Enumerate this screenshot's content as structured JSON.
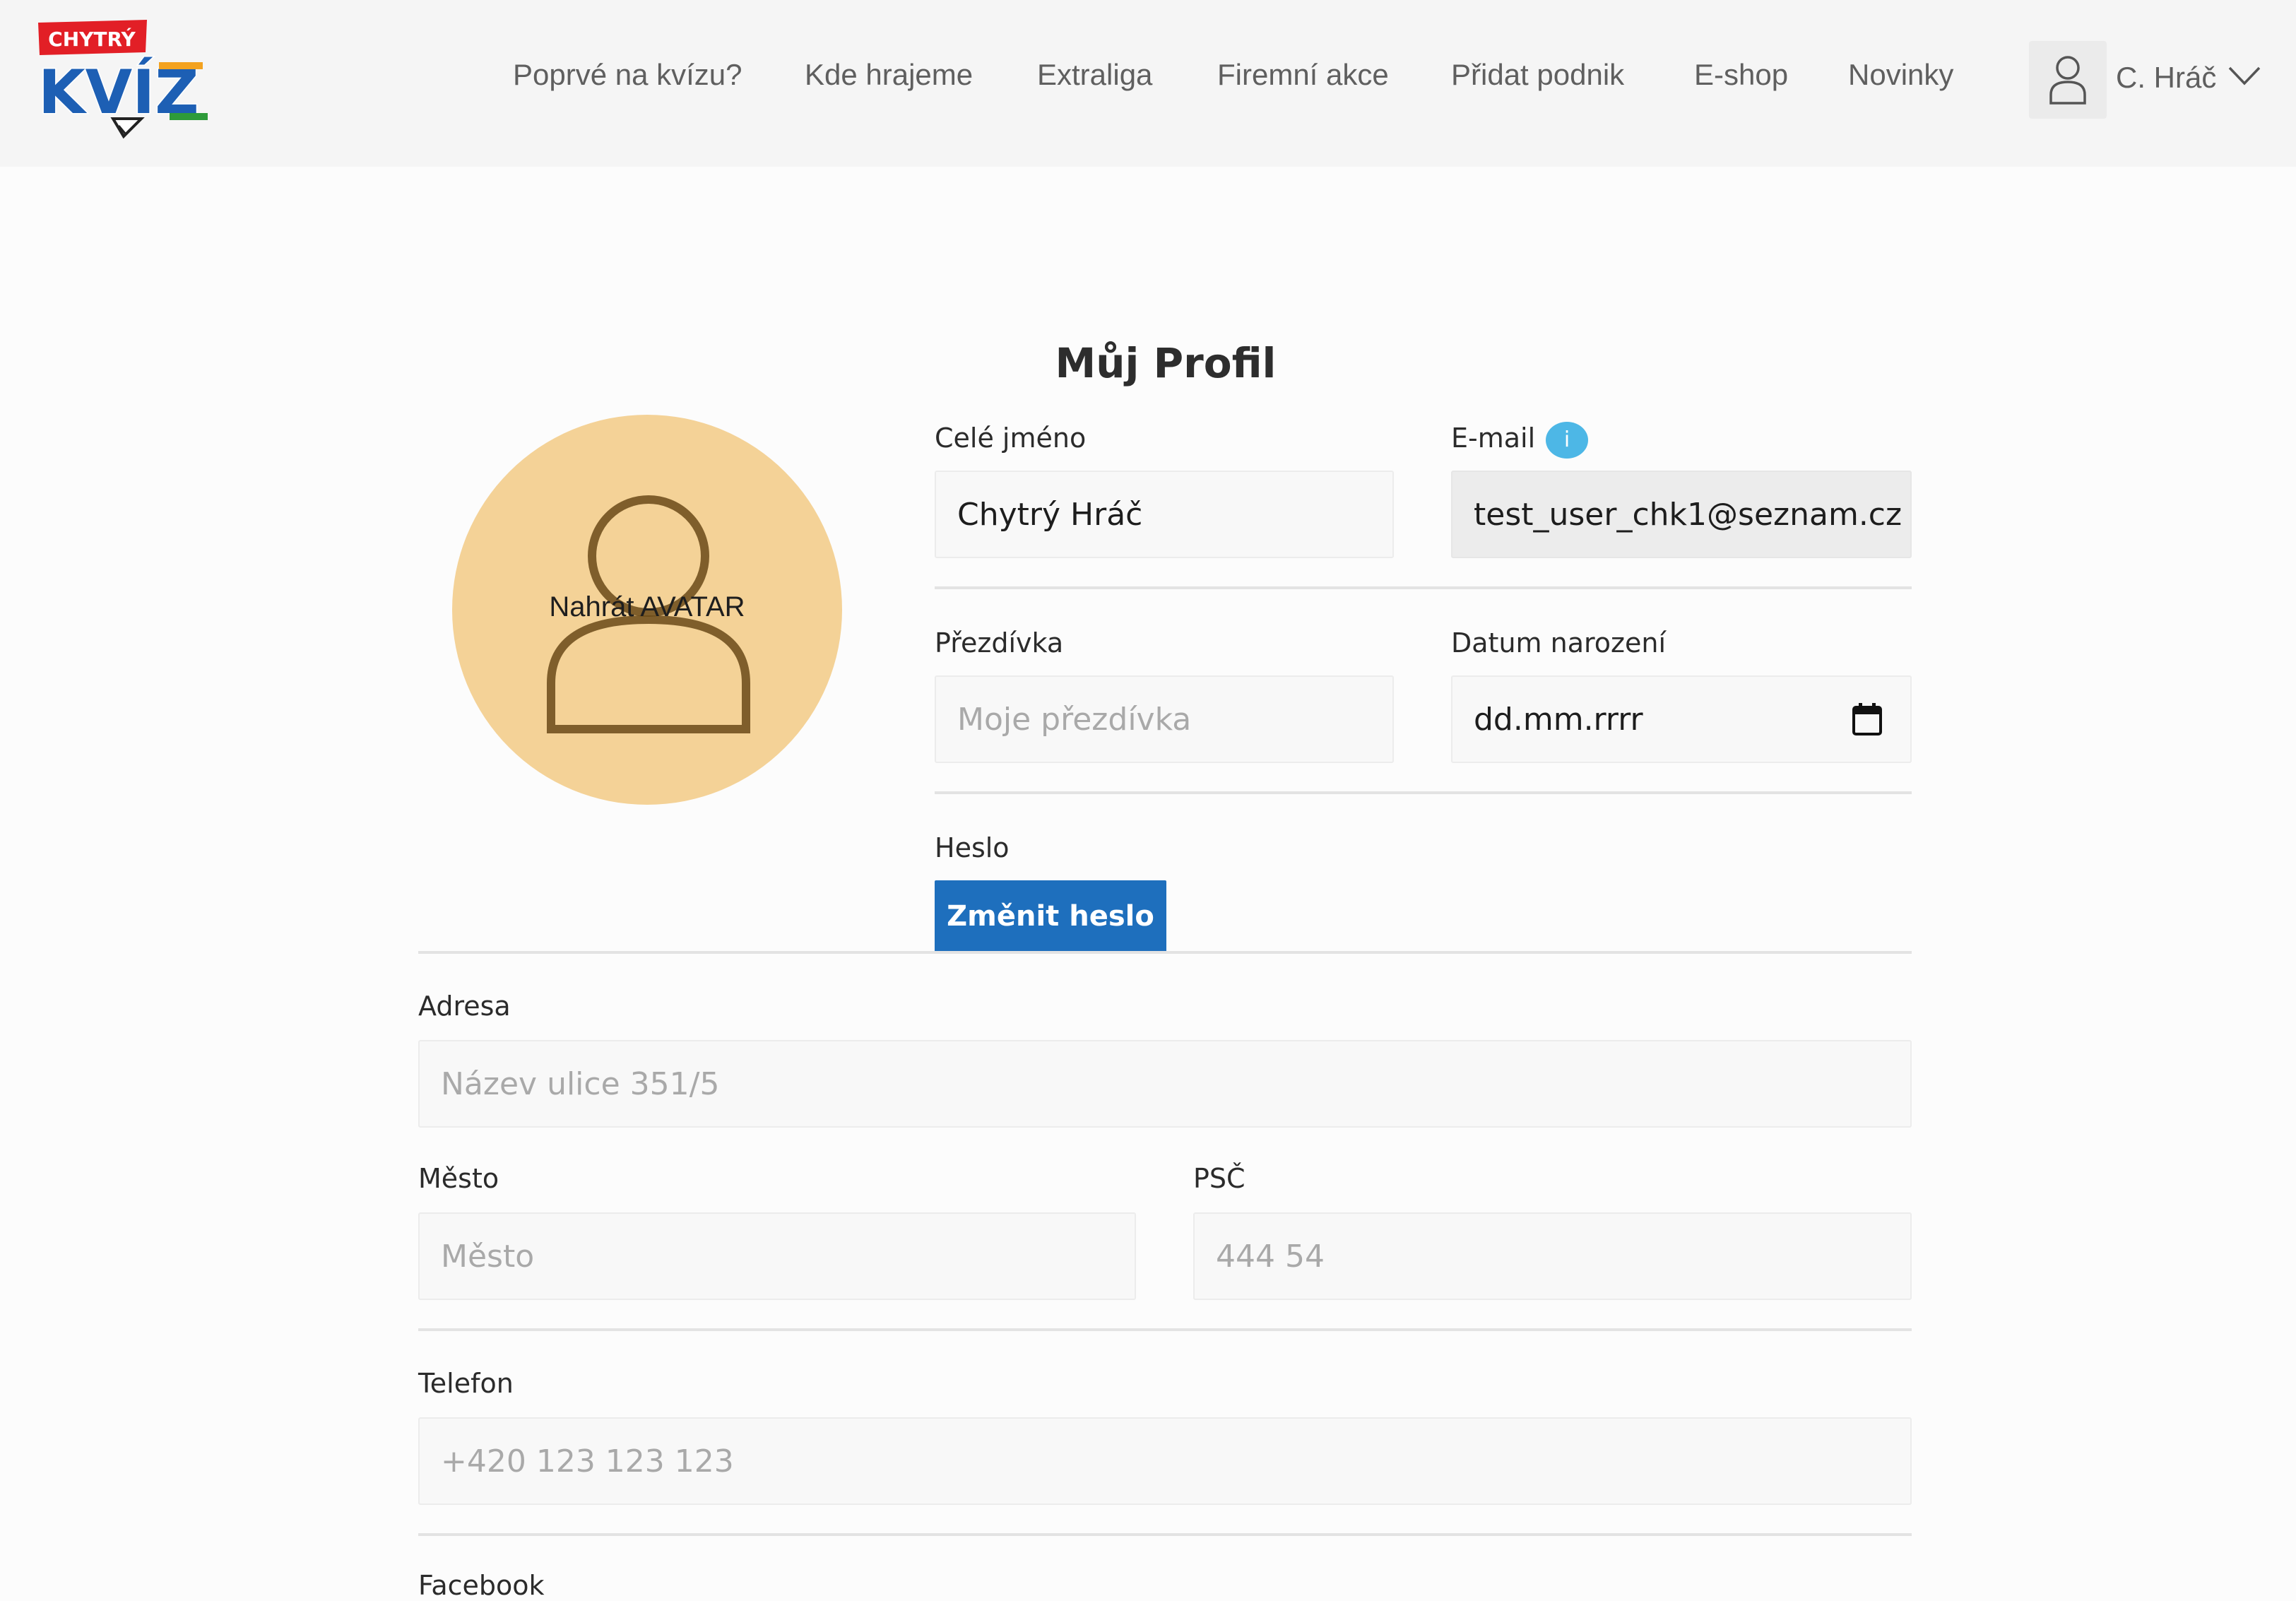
{
  "brand": {
    "logo_top": "CHYTRÝ",
    "logo_main": "KVÍZ",
    "colors": {
      "logo_red": "#e21f26",
      "logo_blue": "#1d5fb4",
      "logo_green": "#2e9b3a",
      "logo_orange": "#f3a21f"
    }
  },
  "header": {
    "nav": [
      {
        "label": "Poprvé na kvízu?"
      },
      {
        "label": "Kde hrajeme"
      },
      {
        "label": "Extraliga"
      },
      {
        "label": "Firemní akce"
      },
      {
        "label": "Přidat podnik"
      },
      {
        "label": "E-shop"
      },
      {
        "label": "Novinky"
      }
    ],
    "user": {
      "name": "C. Hráč",
      "icon": "user-icon",
      "menu_icon": "chevron-down-icon"
    }
  },
  "profile": {
    "title": "Můj Profil",
    "avatar": {
      "label": "Nahrát AVATAR",
      "icon": "user-icon",
      "background": "#f4d297"
    },
    "full_name": {
      "label": "Celé jméno",
      "value": "Chytrý Hráč"
    },
    "email": {
      "label": "E-mail",
      "value": "test_user_chk1@seznam.cz",
      "info_icon": "info-icon",
      "info_symbol": "i"
    },
    "nickname": {
      "label": "Přezdívka",
      "placeholder": "Moje přezdívka"
    },
    "birthdate": {
      "label": "Datum narození",
      "value": "dd.mm.rrrr",
      "icon": "calendar-icon"
    },
    "password": {
      "label": "Heslo",
      "button": "Změnit heslo"
    },
    "address": {
      "label": "Adresa",
      "placeholder": "Název ulice 351/5"
    },
    "city": {
      "label": "Město",
      "placeholder": "Město"
    },
    "zip": {
      "label": "PSČ",
      "placeholder": "444 54"
    },
    "phone": {
      "label": "Telefon",
      "placeholder": "+420 123 123 123"
    },
    "facebook": {
      "label": "Facebook"
    }
  },
  "colors": {
    "primary_button": "#1e6fbd",
    "info_badge": "#4db7e6",
    "header_bg": "#f5f5f5"
  }
}
